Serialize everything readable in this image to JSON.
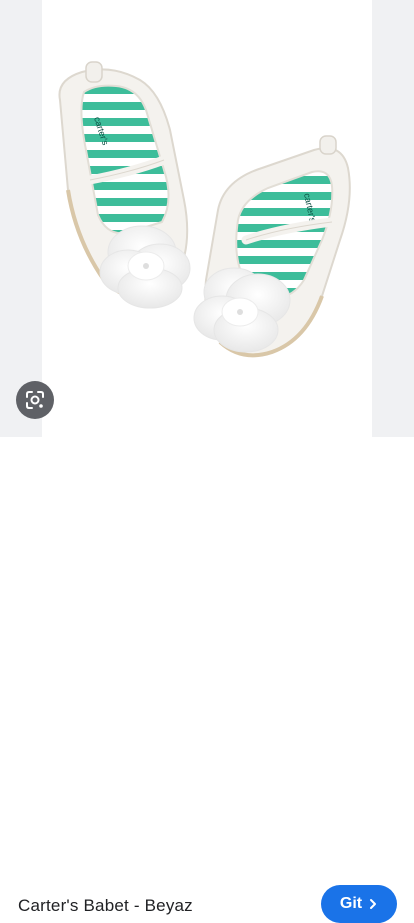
{
  "product": {
    "title": "Carter's Babet - Beyaz",
    "go_label": "Git",
    "shoe_brand_text": "carter's"
  },
  "icons": {
    "lens": "google-lens-icon",
    "chevron": "chevron-right-icon"
  },
  "colors": {
    "accent": "#1a73e8",
    "stripe_green": "#3dbd9a",
    "lens_bg": "#5f6166"
  }
}
